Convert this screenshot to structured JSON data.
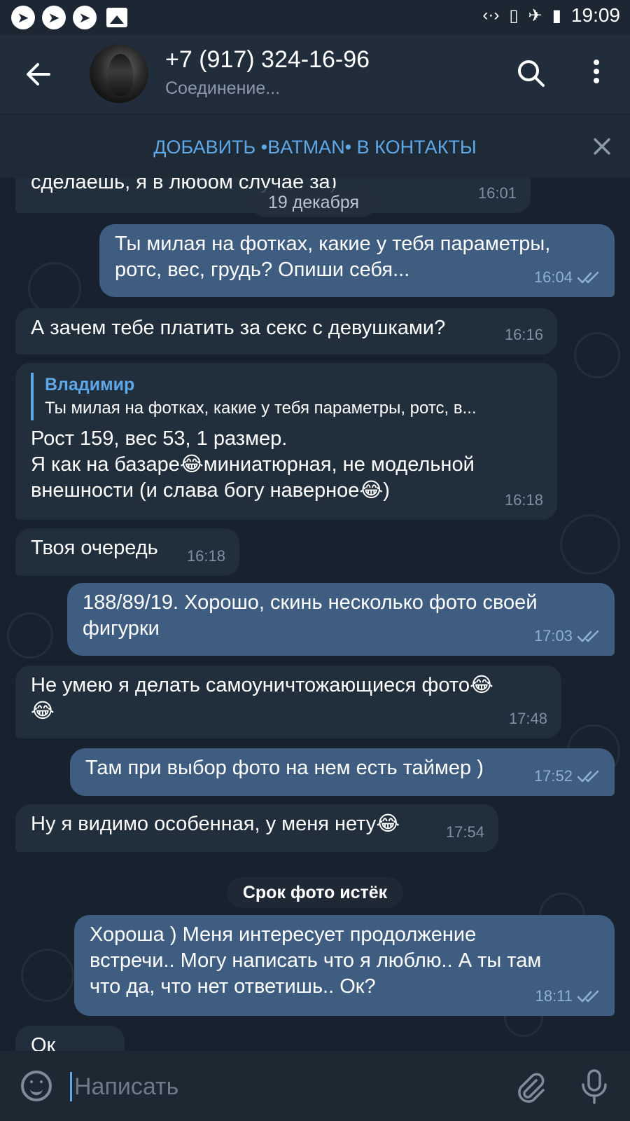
{
  "status_bar": {
    "time": "19:09",
    "left_icons": [
      "telegram-icon",
      "telegram-icon",
      "telegram-icon",
      "image-icon"
    ],
    "right_icons": [
      "data-icon",
      "no-sim-icon",
      "airplane-icon",
      "battery-charging-icon"
    ]
  },
  "header": {
    "contact_name": "+7 (917) 324-16-96",
    "status": "Соединение..."
  },
  "banner": {
    "text": "ДОБАВИТЬ •BATMAN• В КОНТАКТЫ"
  },
  "chat": {
    "date_pill": "19 декабря",
    "service_message": "Срок фото истёк",
    "messages": [
      {
        "dir": "in",
        "text": "сделаешь, я в любом случае за)",
        "time": "16:01"
      },
      {
        "dir": "out",
        "text": "Ты милая на фотках, какие у тебя параметры, ротс, вес, грудь? Опиши себя...",
        "time": "16:04",
        "read": true
      },
      {
        "dir": "in",
        "text": "А зачем тебе платить за секс с девушками?",
        "time": "16:16"
      },
      {
        "dir": "in",
        "reply_name": "Владимир",
        "reply_text": "Ты милая на фотках, какие у тебя параметры, ротс, в...",
        "text_lines": [
          "Рост 159, вес 53, 1 размер.",
          "Я как на базаре😂миниатюрная, не модельной",
          "внешности (и слава богу наверное😂)"
        ],
        "time": "16:18"
      },
      {
        "dir": "in",
        "text": "Твоя очередь",
        "time": "16:18"
      },
      {
        "dir": "out",
        "text_lines": [
          "188/89/19. Хорошо, скинь несколько фото своей",
          "фигурки"
        ],
        "time": "17:03",
        "read": true
      },
      {
        "dir": "in",
        "text_lines": [
          "Не умею я делать самоуничтожающиеся фото😂",
          "😂"
        ],
        "time": "17:48"
      },
      {
        "dir": "out",
        "text": "Там при выбор фото на нем есть таймер )",
        "time": "17:52",
        "read": true
      },
      {
        "dir": "in",
        "text": "Ну я видимо особенная, у меня нету😂",
        "time": "17:54"
      },
      {
        "dir": "out",
        "text_lines": [
          "Хороша ) Меня интересует продолжение",
          "встречи.. Могу написать что я люблю.. А ты там",
          "что да, что нет ответишь.. Ок?"
        ],
        "time": "18:11",
        "read": true
      },
      {
        "dir": "in",
        "text": "Ок",
        "time": ""
      }
    ]
  },
  "composer": {
    "placeholder": "Написать"
  },
  "colors": {
    "accent": "#5fa8e8",
    "incoming_bubble": "#212e3c",
    "outgoing_bubble": "#3e5d80",
    "background": "#18222e"
  }
}
